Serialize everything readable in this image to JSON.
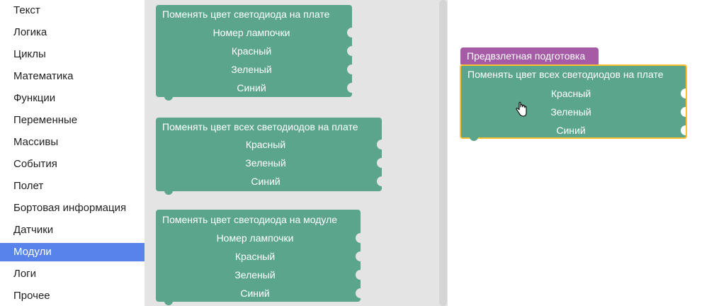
{
  "categories": [
    {
      "label": "Текст"
    },
    {
      "label": "Логика"
    },
    {
      "label": "Циклы"
    },
    {
      "label": "Математика"
    },
    {
      "label": "Функции"
    },
    {
      "label": "Переменные"
    },
    {
      "label": "Массивы"
    },
    {
      "label": "События"
    },
    {
      "label": "Полет"
    },
    {
      "label": "Бортовая информация"
    },
    {
      "label": "Датчики"
    },
    {
      "label": "Модули"
    },
    {
      "label": "Логи"
    },
    {
      "label": "Прочее"
    }
  ],
  "selected_category": "Модули",
  "flyout": {
    "block1": {
      "title": "Поменять цвет светодиода на плате",
      "fields": [
        "Номер лампочки",
        "Красный",
        "Зеленый",
        "Синий"
      ]
    },
    "block2": {
      "title": "Поменять цвет всех светодиодов на плате",
      "fields": [
        "Красный",
        "Зеленый",
        "Синий"
      ]
    },
    "block3": {
      "title": "Поменять цвет светодиода на модуле",
      "fields": [
        "Номер лампочки",
        "Красный",
        "Зеленый",
        "Синий"
      ]
    }
  },
  "workspace": {
    "hat_block": {
      "title": "Предвзлетная подготовка"
    },
    "led_block": {
      "title": "Поменять цвет всех светодиодов на плате",
      "fields": [
        "Красный",
        "Зеленый",
        "Синий"
      ]
    }
  },
  "colors": {
    "block_green": "#5ba58c",
    "hat_purple": "#a55ba5",
    "selected_category": "#5783ea",
    "selection_outline": "#fbc02d",
    "flyout_bg": "#e4e4e4"
  },
  "icons": {
    "cursor": "hand-pointer-icon"
  }
}
